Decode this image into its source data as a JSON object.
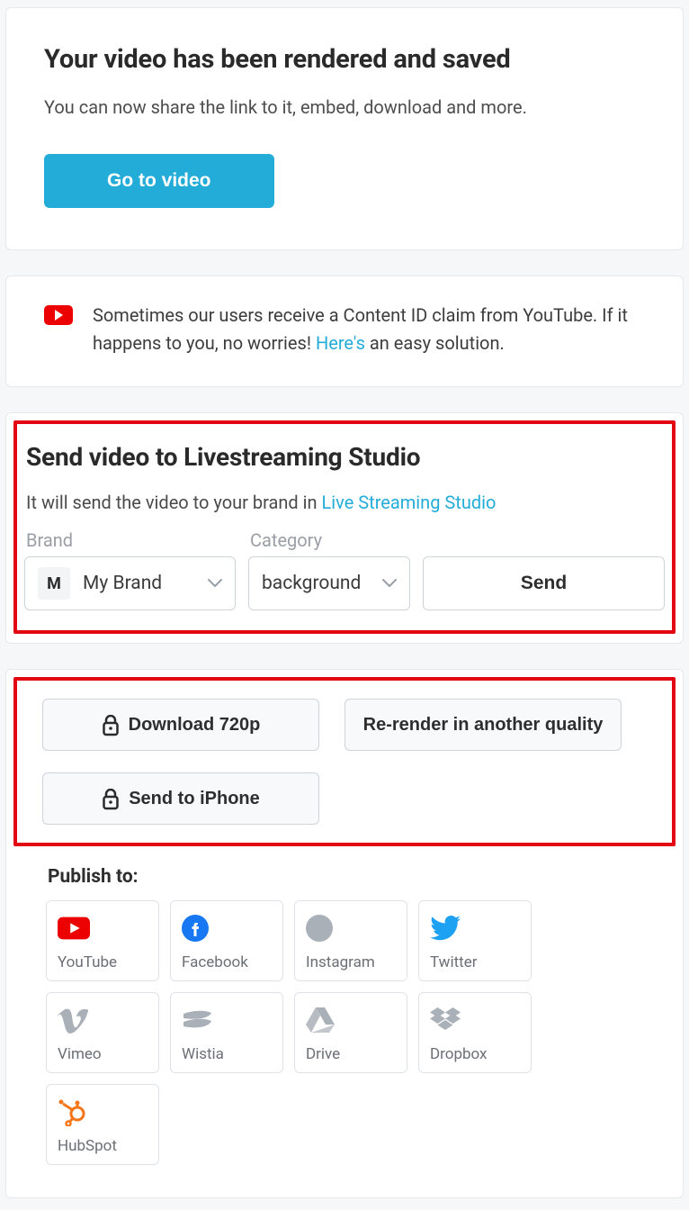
{
  "header": {
    "title": "Your video has been rendered and saved",
    "subtitle": "You can now share the link to it, embed, download and more.",
    "go_label": "Go to video"
  },
  "notice": {
    "text_a": "Sometimes our users receive a Content ID claim from YouTube. If it happens to you, no worries! ",
    "link": "Here's",
    "text_b": " an easy solution."
  },
  "livestream": {
    "title": "Send video to Livestreaming Studio",
    "desc_a": "It will send the video to your brand in ",
    "desc_link": "Live Streaming Studio",
    "brand_label": "Brand",
    "category_label": "Category",
    "brand_avatar": "M",
    "brand_value": "My Brand",
    "category_value": "background",
    "send_label": "Send"
  },
  "actions": {
    "download_label": "Download 720p",
    "rerender_label": "Re-render in another quality",
    "send_iphone_label": "Send to iPhone"
  },
  "publish": {
    "title": "Publish to:",
    "items": [
      {
        "label": "YouTube"
      },
      {
        "label": "Facebook"
      },
      {
        "label": "Instagram"
      },
      {
        "label": "Twitter"
      },
      {
        "label": "Vimeo"
      },
      {
        "label": "Wistia"
      },
      {
        "label": "Drive"
      },
      {
        "label": "Dropbox"
      },
      {
        "label": "HubSpot"
      }
    ]
  }
}
